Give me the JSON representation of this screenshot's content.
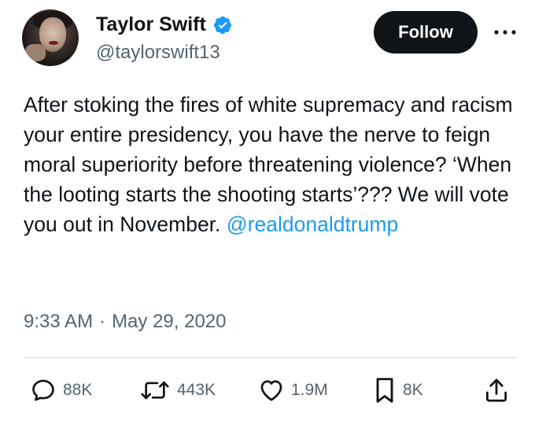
{
  "author": {
    "display_name": "Taylor Swift",
    "handle": "@taylorswift13",
    "verified": true,
    "avatar_icon": "profile-photo"
  },
  "follow_label": "Follow",
  "more_icon": "more-horizontal-icon",
  "tweet": {
    "text_before_mention": "After stoking the fires of white supremacy and racism your entire presidency, you have the nerve to feign moral superiority before threatening violence? ‘When the looting starts the shooting starts’??? We will vote you out in November. ",
    "mention": "@realdonaldtrump"
  },
  "meta": {
    "time": "9:33 AM",
    "separator": "·",
    "date": "May 29, 2020"
  },
  "actions": {
    "replies": "88K",
    "retweets": "443K",
    "likes": "1.9M",
    "bookmarks": "8K"
  },
  "colors": {
    "text": "#0f1419",
    "secondary": "#536471",
    "link": "#1d9bf0",
    "verified": "#1d9bf0",
    "follow_bg": "#0f1419"
  }
}
